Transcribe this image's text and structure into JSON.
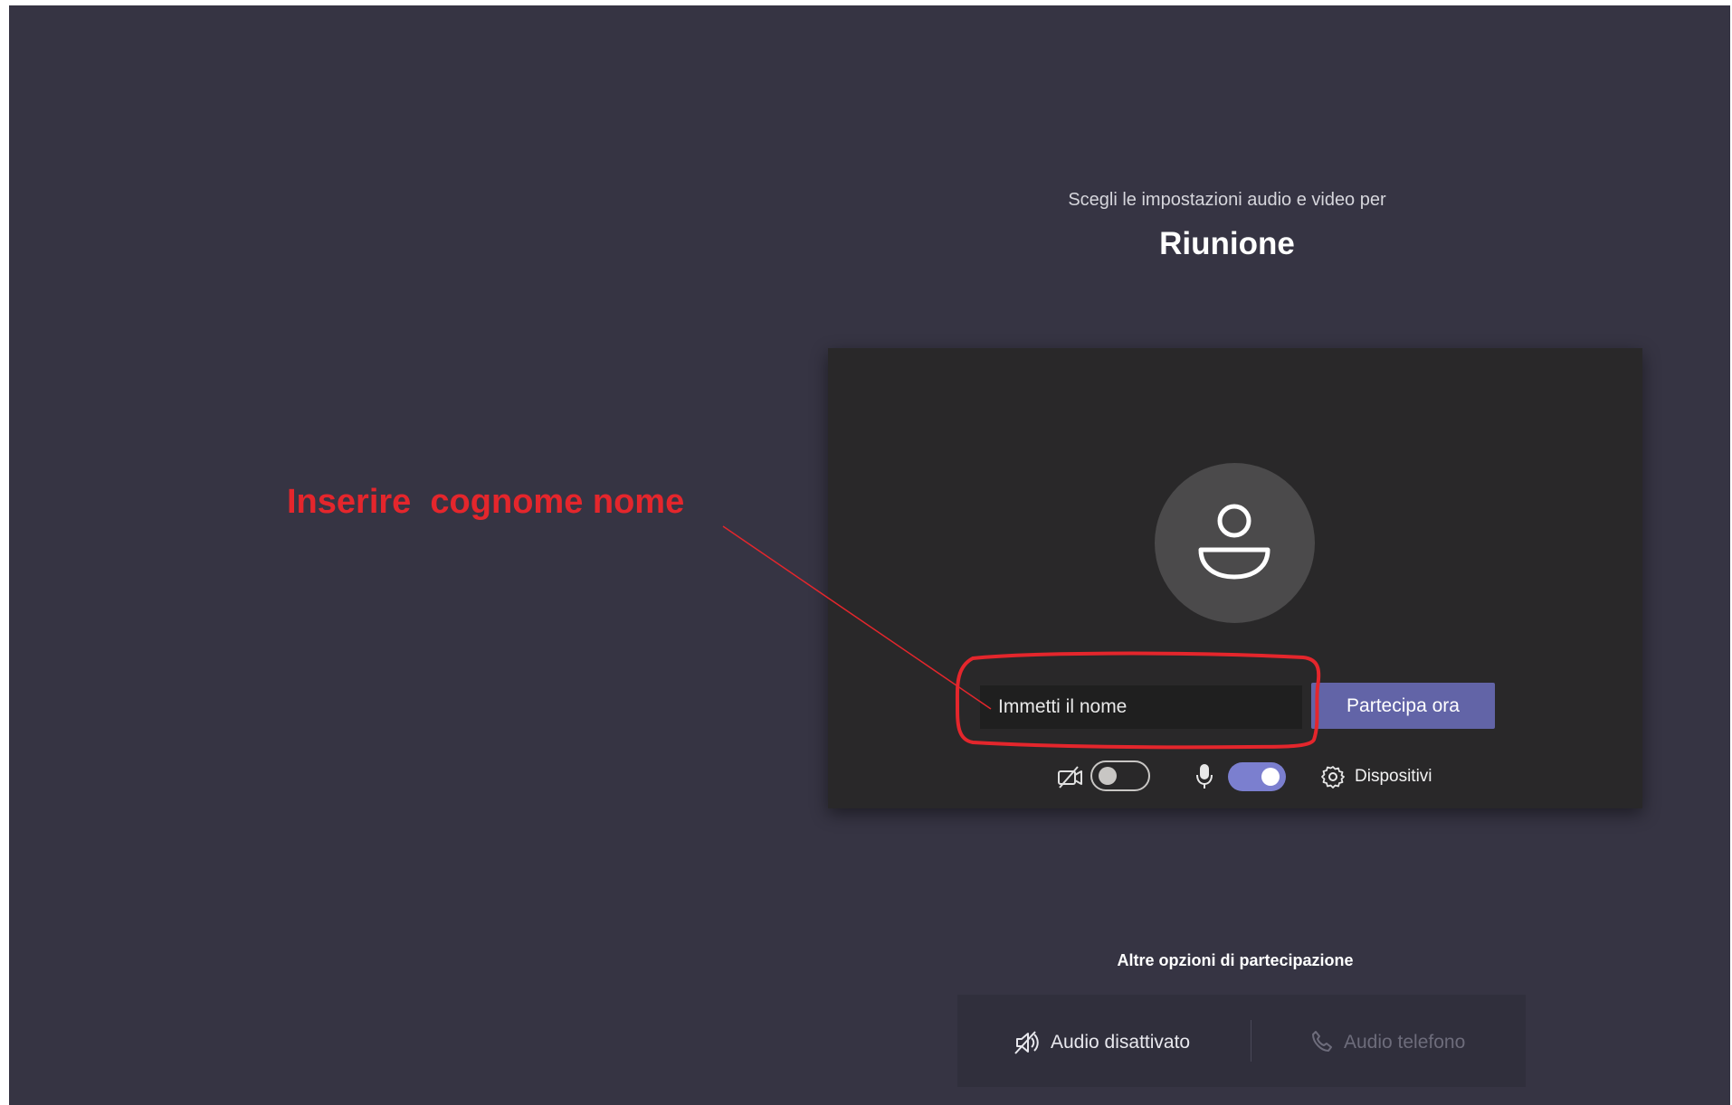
{
  "meeting": {
    "subtitle": "Scegli le impostazioni audio e video per",
    "title": "Riunione"
  },
  "join": {
    "name_placeholder": "Immetti il nome",
    "join_button": "Partecipa ora"
  },
  "controls": {
    "camera": {
      "icon": "camera-off-icon",
      "enabled": false
    },
    "microphone": {
      "icon": "microphone-icon",
      "enabled": true
    },
    "devices_label": "Dispositivi",
    "devices_icon": "gear-icon"
  },
  "other_options": {
    "heading": "Altre opzioni di partecipazione",
    "audio_off_label": "Audio disattivato",
    "audio_off_icon": "speaker-muted-icon",
    "phone_audio_label": "Audio telefono",
    "phone_audio_icon": "phone-icon"
  },
  "annotation": {
    "text": "Inserire  cognome nome",
    "color": "#e4262c"
  },
  "colors": {
    "background": "#363443",
    "panel": "#292829",
    "accent": "#6264a7",
    "toggle_on": "#7b7fcf"
  }
}
